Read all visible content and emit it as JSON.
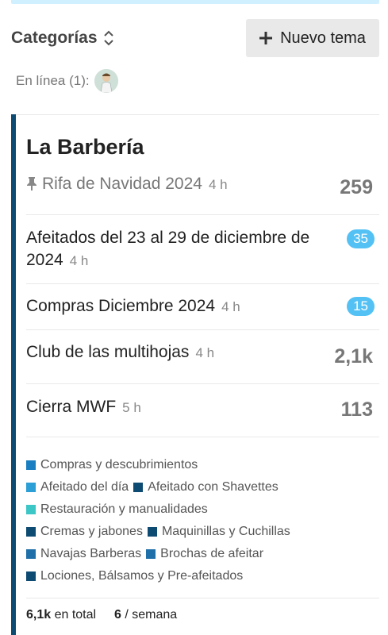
{
  "header": {
    "categories_label": "Categorías",
    "new_topic_label": "Nuevo tema"
  },
  "online": {
    "label": "En línea (1):"
  },
  "category": {
    "title": "La Barbería",
    "color": "#0e4b73",
    "topics": [
      {
        "title": "Rifa de Navidad 2024",
        "age": "4 h",
        "pinned": true,
        "count": "259"
      },
      {
        "title": "Afeitados del 23 al 29 de diciembre de 2024",
        "age": "4 h",
        "badge": "35"
      },
      {
        "title": "Compras Diciembre 2024",
        "age": "4 h",
        "badge": "15"
      },
      {
        "title": "Club de las multihojas",
        "age": "4 h",
        "count": "2,1k"
      },
      {
        "title": "Cierra MWF",
        "age": "5 h",
        "count": "113"
      }
    ],
    "subcategories": [
      {
        "name": "Compras y descubrimientos",
        "color": "#1a7fc1"
      },
      {
        "name": "Afeitado del día",
        "color": "#2b9fd6"
      },
      {
        "name": "Afeitado con Shavettes",
        "color": "#0e4b73"
      },
      {
        "name": "Restauración y manualidades",
        "color": "#3cc6c6"
      },
      {
        "name": "Cremas y jabones",
        "color": "#0e4b73"
      },
      {
        "name": "Maquinillas y Cuchillas",
        "color": "#0e4b73"
      },
      {
        "name": "Navajas Barberas",
        "color": "#1f6fa8"
      },
      {
        "name": "Brochas de afeitar",
        "color": "#1f6fa8"
      },
      {
        "name": "Lociones, Bálsamos y Pre-afeitados",
        "color": "#0e4b73"
      }
    ],
    "stats": {
      "total_value": "6,1k",
      "total_label": "en total",
      "weekly_value": "6",
      "weekly_label": "/ semana"
    }
  },
  "colors": {
    "badge": "#54c1f5",
    "category_bar": "#0e4b73",
    "top_strip": "#d1f0ff"
  }
}
